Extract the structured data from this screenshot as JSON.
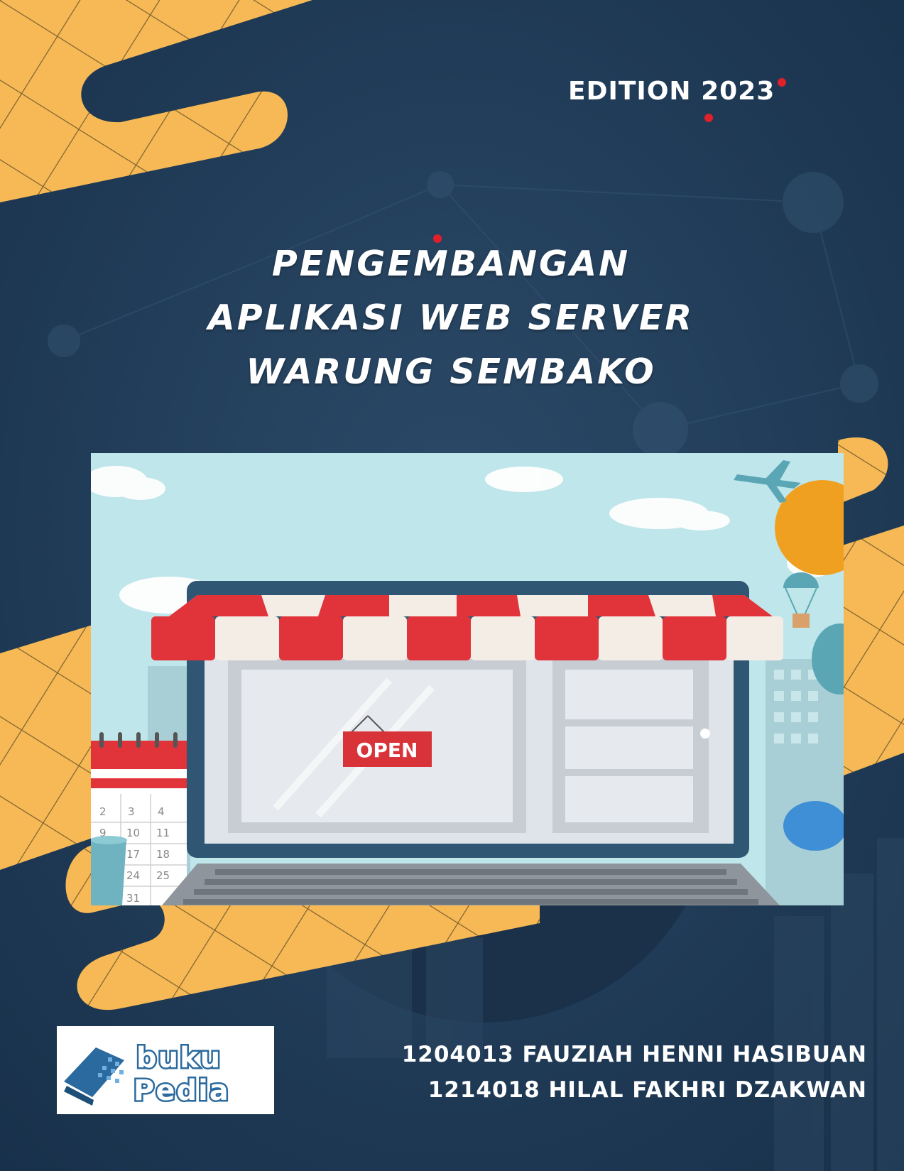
{
  "cover": {
    "edition": "EDITION 2023",
    "title_lines": [
      "PENGEMBANGAN",
      "APLIKASI WEB SERVER",
      "WARUNG SEMBAKO"
    ],
    "authors": [
      "1204013 FAUZIAH HENNI HASIBUAN",
      "1214018 HILAL FAKHRI DZAKWAN"
    ],
    "publisher_logo": {
      "line1": "buku",
      "line2": "Pedia"
    }
  },
  "illustration": {
    "sign_text": "OPEN",
    "calendar_rows": [
      [
        "2",
        "3",
        "4"
      ],
      [
        "9",
        "10",
        "11"
      ],
      [
        "17",
        "18"
      ],
      [
        "24",
        "25"
      ],
      [
        "31"
      ]
    ]
  },
  "colors": {
    "background": "#1f3a55",
    "accent_orange": "#f7b955",
    "awning_red": "#e0333a",
    "sky": "#bfe6ea",
    "text": "#ffffff"
  }
}
